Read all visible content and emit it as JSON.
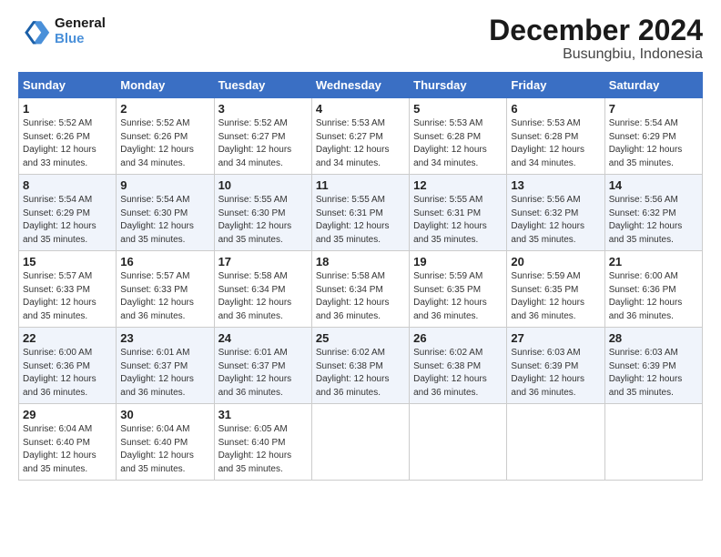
{
  "header": {
    "logo_line1": "General",
    "logo_line2": "Blue",
    "title": "December 2024",
    "subtitle": "Busungbiu, Indonesia"
  },
  "columns": [
    "Sunday",
    "Monday",
    "Tuesday",
    "Wednesday",
    "Thursday",
    "Friday",
    "Saturday"
  ],
  "weeks": [
    [
      {
        "day": "1",
        "sunrise": "5:52 AM",
        "sunset": "6:26 PM",
        "daylight": "12 hours and 33 minutes."
      },
      {
        "day": "2",
        "sunrise": "5:52 AM",
        "sunset": "6:26 PM",
        "daylight": "12 hours and 34 minutes."
      },
      {
        "day": "3",
        "sunrise": "5:52 AM",
        "sunset": "6:27 PM",
        "daylight": "12 hours and 34 minutes."
      },
      {
        "day": "4",
        "sunrise": "5:53 AM",
        "sunset": "6:27 PM",
        "daylight": "12 hours and 34 minutes."
      },
      {
        "day": "5",
        "sunrise": "5:53 AM",
        "sunset": "6:28 PM",
        "daylight": "12 hours and 34 minutes."
      },
      {
        "day": "6",
        "sunrise": "5:53 AM",
        "sunset": "6:28 PM",
        "daylight": "12 hours and 34 minutes."
      },
      {
        "day": "7",
        "sunrise": "5:54 AM",
        "sunset": "6:29 PM",
        "daylight": "12 hours and 35 minutes."
      }
    ],
    [
      {
        "day": "8",
        "sunrise": "5:54 AM",
        "sunset": "6:29 PM",
        "daylight": "12 hours and 35 minutes."
      },
      {
        "day": "9",
        "sunrise": "5:54 AM",
        "sunset": "6:30 PM",
        "daylight": "12 hours and 35 minutes."
      },
      {
        "day": "10",
        "sunrise": "5:55 AM",
        "sunset": "6:30 PM",
        "daylight": "12 hours and 35 minutes."
      },
      {
        "day": "11",
        "sunrise": "5:55 AM",
        "sunset": "6:31 PM",
        "daylight": "12 hours and 35 minutes."
      },
      {
        "day": "12",
        "sunrise": "5:55 AM",
        "sunset": "6:31 PM",
        "daylight": "12 hours and 35 minutes."
      },
      {
        "day": "13",
        "sunrise": "5:56 AM",
        "sunset": "6:32 PM",
        "daylight": "12 hours and 35 minutes."
      },
      {
        "day": "14",
        "sunrise": "5:56 AM",
        "sunset": "6:32 PM",
        "daylight": "12 hours and 35 minutes."
      }
    ],
    [
      {
        "day": "15",
        "sunrise": "5:57 AM",
        "sunset": "6:33 PM",
        "daylight": "12 hours and 35 minutes."
      },
      {
        "day": "16",
        "sunrise": "5:57 AM",
        "sunset": "6:33 PM",
        "daylight": "12 hours and 36 minutes."
      },
      {
        "day": "17",
        "sunrise": "5:58 AM",
        "sunset": "6:34 PM",
        "daylight": "12 hours and 36 minutes."
      },
      {
        "day": "18",
        "sunrise": "5:58 AM",
        "sunset": "6:34 PM",
        "daylight": "12 hours and 36 minutes."
      },
      {
        "day": "19",
        "sunrise": "5:59 AM",
        "sunset": "6:35 PM",
        "daylight": "12 hours and 36 minutes."
      },
      {
        "day": "20",
        "sunrise": "5:59 AM",
        "sunset": "6:35 PM",
        "daylight": "12 hours and 36 minutes."
      },
      {
        "day": "21",
        "sunrise": "6:00 AM",
        "sunset": "6:36 PM",
        "daylight": "12 hours and 36 minutes."
      }
    ],
    [
      {
        "day": "22",
        "sunrise": "6:00 AM",
        "sunset": "6:36 PM",
        "daylight": "12 hours and 36 minutes."
      },
      {
        "day": "23",
        "sunrise": "6:01 AM",
        "sunset": "6:37 PM",
        "daylight": "12 hours and 36 minutes."
      },
      {
        "day": "24",
        "sunrise": "6:01 AM",
        "sunset": "6:37 PM",
        "daylight": "12 hours and 36 minutes."
      },
      {
        "day": "25",
        "sunrise": "6:02 AM",
        "sunset": "6:38 PM",
        "daylight": "12 hours and 36 minutes."
      },
      {
        "day": "26",
        "sunrise": "6:02 AM",
        "sunset": "6:38 PM",
        "daylight": "12 hours and 36 minutes."
      },
      {
        "day": "27",
        "sunrise": "6:03 AM",
        "sunset": "6:39 PM",
        "daylight": "12 hours and 36 minutes."
      },
      {
        "day": "28",
        "sunrise": "6:03 AM",
        "sunset": "6:39 PM",
        "daylight": "12 hours and 35 minutes."
      }
    ],
    [
      {
        "day": "29",
        "sunrise": "6:04 AM",
        "sunset": "6:40 PM",
        "daylight": "12 hours and 35 minutes."
      },
      {
        "day": "30",
        "sunrise": "6:04 AM",
        "sunset": "6:40 PM",
        "daylight": "12 hours and 35 minutes."
      },
      {
        "day": "31",
        "sunrise": "6:05 AM",
        "sunset": "6:40 PM",
        "daylight": "12 hours and 35 minutes."
      },
      null,
      null,
      null,
      null
    ]
  ]
}
